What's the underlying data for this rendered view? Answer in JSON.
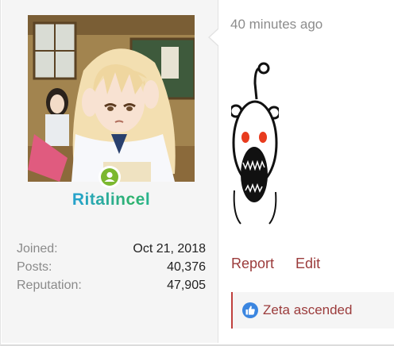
{
  "user": {
    "username": "Ritalincel",
    "online": true,
    "stats": [
      {
        "label": "Joined:",
        "value": "Oct 21, 2018"
      },
      {
        "label": "Posts:",
        "value": "40,376"
      },
      {
        "label": "Reputation:",
        "value": "47,905"
      }
    ]
  },
  "post": {
    "timestamp": "40 minutes ago",
    "image_icon": "reddit-alien-screaming-image",
    "actions": {
      "report": "Report",
      "edit": "Edit"
    },
    "likes": {
      "icon": "thumbs-up-icon",
      "text": "Zeta ascended"
    }
  },
  "colors": {
    "link": "#9b3b3b",
    "online": "#7cb82f",
    "like": "#3b86e0",
    "accent_border": "#c0403e"
  }
}
